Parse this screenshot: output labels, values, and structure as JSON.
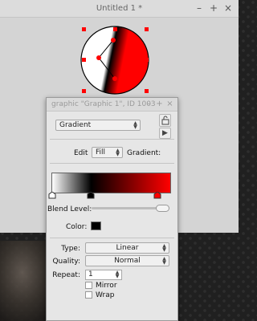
{
  "main_window": {
    "title": "Untitled 1 *",
    "min_icon": "–",
    "max_icon": "+",
    "close_icon": "×"
  },
  "palette": {
    "title": "graphic \"Graphic 1\", ID 1003",
    "fill_style": "Gradient",
    "edit_label": "Edit",
    "edit_target": "Fill",
    "gradient_label": "Gradient:",
    "blend_level_label": "Blend Level:",
    "blend_level": 1.0,
    "color_label": "Color:",
    "color": "#000000",
    "type_label": "Type:",
    "type_value": "Linear",
    "quality_label": "Quality:",
    "quality_value": "Normal",
    "repeat_label": "Repeat:",
    "repeat_value": "1",
    "mirror_label": "Mirror",
    "wrap_label": "Wrap"
  },
  "gradient_stops": [
    {
      "position": 0.0,
      "color": "#ffffff"
    },
    {
      "position": 0.33,
      "color": "#000000"
    },
    {
      "position": 0.88,
      "color": "#ff0000"
    }
  ],
  "colors": {
    "selection_handle": "#ff0000",
    "shape_fill_primary": "#ff0000"
  }
}
